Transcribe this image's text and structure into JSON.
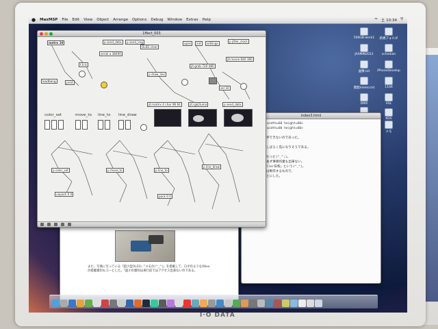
{
  "menubar": {
    "apple": "",
    "app_name": "MaxMSP",
    "items": [
      "File",
      "Edit",
      "View",
      "Object",
      "Arrange",
      "Options",
      "Debug",
      "Window",
      "Extras",
      "Help"
    ],
    "clock": "土 10:34"
  },
  "patcher": {
    "title": "1ffect_003",
    "sections": [
      "color_set",
      "move_to",
      "line_to",
      "line_draw"
    ],
    "objects": [
      "metro 10",
      "OLED clear",
      "p send_data",
      "p send_img",
      "serial a 38400",
      "open",
      "init",
      "settings",
      "p jitter_clock",
      "jit.grab 720 480",
      "jit.movie 640 360",
      "t b b",
      "print",
      "loadbang",
      "p draw_line",
      "jit.matrix 4 char 96 64",
      "jit.rgb2luma",
      "p send_data",
      "sel 10",
      "p color_set",
      "p move_to",
      "p line_to",
      "p line_draw",
      "unpack 0 0",
      "pack 0 0"
    ]
  },
  "editor": {
    "title": "index3.html",
    "lines": [
      "C00791.JPG\" width=60 height=60>",
      "C00795.JPG\" width=60 height=60>",
      "",
      "み、まだまだ着手できないのであった。",
      "本",
      "復活したいが、しばらく先になりそうである。",
      "",
      "んと以下に記述だった(^_^;)。",
      "と部も制作も延長ず事務作業も出来ない。",
      "これを「Propeller日和」という(^_^)。",
      "として以上作品は制作するもので、",
      "あるのであることにした。"
    ]
  },
  "browser": {
    "caption": "また、写真に写っている「超小型OLED」「メモの(^_^)」を搭載して、ロボのようなXBeeの搭載資料もコーとした。「超小の資料は来行前ではアクセス出来ないのである。",
    "status": "Done"
  },
  "desktop_icons": [
    "500GB-work1",
    "新規フォルダ",
    "JASMIN2012",
    "schedule",
    "画像.txt",
    "iPhoneDevelop",
    "1106",
    "開発memo.txt",
    "DMX",
    "ASL",
    "PropStick USB.pdf",
    "Raspberry Pi",
    "KDS",
    "メモ"
  ],
  "monitor": {
    "brand": "I·O DATA"
  },
  "colors": {
    "patch_bg": "#f0f0ef",
    "yellow_knob": "#f7d12b",
    "cam_bg": "#1c1b24"
  }
}
